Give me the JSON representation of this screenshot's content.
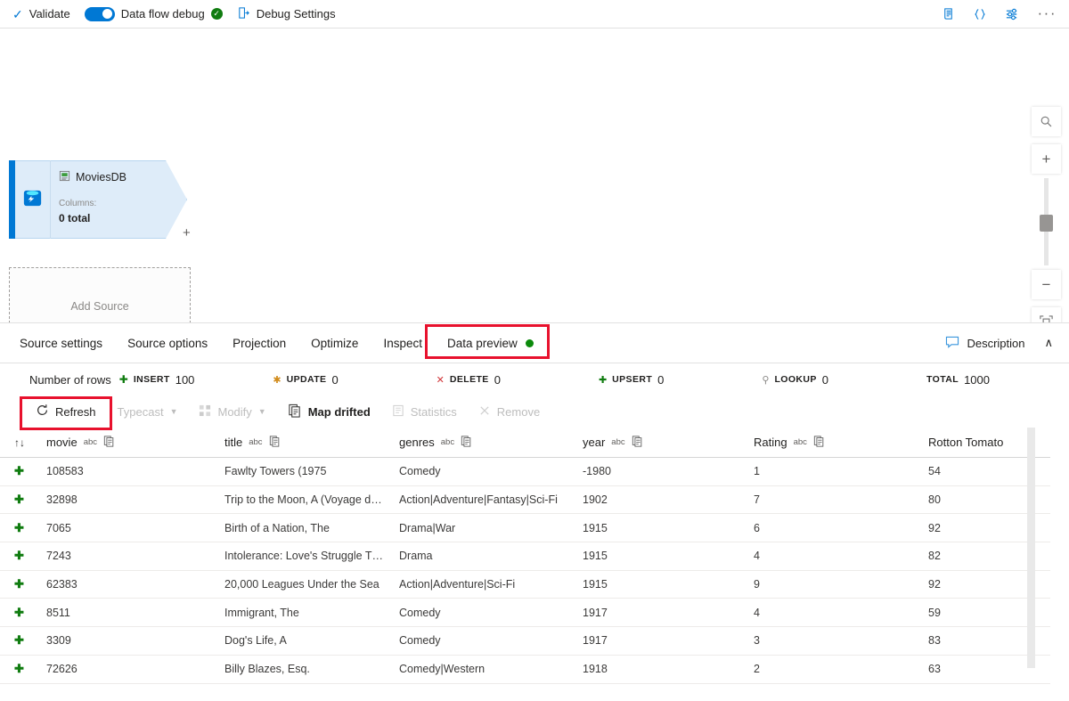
{
  "toolbar": {
    "validate": "Validate",
    "debug_label": "Data flow debug",
    "debug_settings": "Debug Settings",
    "icons": {
      "check": "check-icon",
      "status": "status-ok-icon",
      "debug": "debug-settings-icon",
      "script": "script-icon",
      "code": "{}",
      "settings": "settings-sliders-icon",
      "more": "···"
    }
  },
  "canvas": {
    "node": {
      "title": "MoviesDB",
      "columns_label": "Columns:",
      "columns_value": "0 total",
      "plus": "+"
    },
    "add_source": "Add Source",
    "zoom": {
      "search": "⚲",
      "zoom_in": "+",
      "zoom_out": "−",
      "fit": "fit-to-screen-icon"
    }
  },
  "tabs": {
    "items": [
      {
        "label": "Source settings",
        "active": false
      },
      {
        "label": "Source options",
        "active": false
      },
      {
        "label": "Projection",
        "active": false
      },
      {
        "label": "Optimize",
        "active": false
      },
      {
        "label": "Inspect",
        "active": false
      },
      {
        "label": "Data preview",
        "active": true
      }
    ],
    "description": "Description",
    "collapse": "∧",
    "status_color": "#0b8a0b"
  },
  "stats": {
    "rows_label": "Number of rows",
    "items": [
      {
        "label": "INSERT",
        "value": "100",
        "icon": "✚",
        "color": "#107c10"
      },
      {
        "label": "UPDATE",
        "value": "0",
        "icon": "✱",
        "color": "#d18b1b"
      },
      {
        "label": "DELETE",
        "value": "0",
        "icon": "✕",
        "color": "#d13438"
      },
      {
        "label": "UPSERT",
        "value": "0",
        "icon": "✚",
        "color": "#107c10"
      },
      {
        "label": "LOOKUP",
        "value": "0",
        "icon": "⚲",
        "color": "#8a8886"
      },
      {
        "label": "TOTAL",
        "value": "1000",
        "icon": "",
        "color": "#201f1e"
      }
    ]
  },
  "actions": [
    {
      "label": "Refresh",
      "icon": "refresh-icon",
      "disabled": false
    },
    {
      "label": "Typecast",
      "icon": "typecast-icon",
      "disabled": true,
      "caret": true
    },
    {
      "label": "Modify",
      "icon": "modify-icon",
      "disabled": true,
      "caret": true
    },
    {
      "label": "Map drifted",
      "icon": "map-drifted-icon",
      "disabled": false
    },
    {
      "label": "Statistics",
      "icon": "statistics-icon",
      "disabled": true
    },
    {
      "label": "Remove",
      "icon": "remove-icon",
      "disabled": true
    }
  ],
  "table": {
    "sort_icon": "↑↓",
    "type_tag": "abc",
    "columns": [
      {
        "name": "movie",
        "type": "abc",
        "has_type": true
      },
      {
        "name": "title",
        "type": "abc",
        "has_type": true
      },
      {
        "name": "genres",
        "type": "abc",
        "has_type": true
      },
      {
        "name": "year",
        "type": "abc",
        "has_type": true
      },
      {
        "name": "Rating",
        "type": "abc",
        "has_type": true
      },
      {
        "name": "Rotton Tomato",
        "type": "",
        "has_type": false
      }
    ],
    "rows": [
      {
        "mark": "✚",
        "movie": "108583",
        "title": "Fawlty Towers (1975",
        "genres": "Comedy",
        "year": "-1980",
        "rating": "1",
        "tomato": "54"
      },
      {
        "mark": "✚",
        "movie": "32898",
        "title": "Trip to the Moon, A (Voyage d…",
        "genres": "Action|Adventure|Fantasy|Sci-Fi",
        "year": "1902",
        "rating": "7",
        "tomato": "80"
      },
      {
        "mark": "✚",
        "movie": "7065",
        "title": "Birth of a Nation, The",
        "genres": "Drama|War",
        "year": "1915",
        "rating": "6",
        "tomato": "92"
      },
      {
        "mark": "✚",
        "movie": "7243",
        "title": "Intolerance: Love's Struggle T…",
        "genres": "Drama",
        "year": "1915",
        "rating": "4",
        "tomato": "82"
      },
      {
        "mark": "✚",
        "movie": "62383",
        "title": "20,000 Leagues Under the Sea",
        "genres": "Action|Adventure|Sci-Fi",
        "year": "1915",
        "rating": "9",
        "tomato": "92"
      },
      {
        "mark": "✚",
        "movie": "8511",
        "title": "Immigrant, The",
        "genres": "Comedy",
        "year": "1917",
        "rating": "4",
        "tomato": "59"
      },
      {
        "mark": "✚",
        "movie": "3309",
        "title": "Dog's Life, A",
        "genres": "Comedy",
        "year": "1917",
        "rating": "3",
        "tomato": "83"
      },
      {
        "mark": "✚",
        "movie": "72626",
        "title": "Billy Blazes, Esq.",
        "genres": "Comedy|Western",
        "year": "1918",
        "rating": "2",
        "tomato": "63"
      }
    ]
  },
  "annotations": {
    "color": "#e8112d"
  }
}
